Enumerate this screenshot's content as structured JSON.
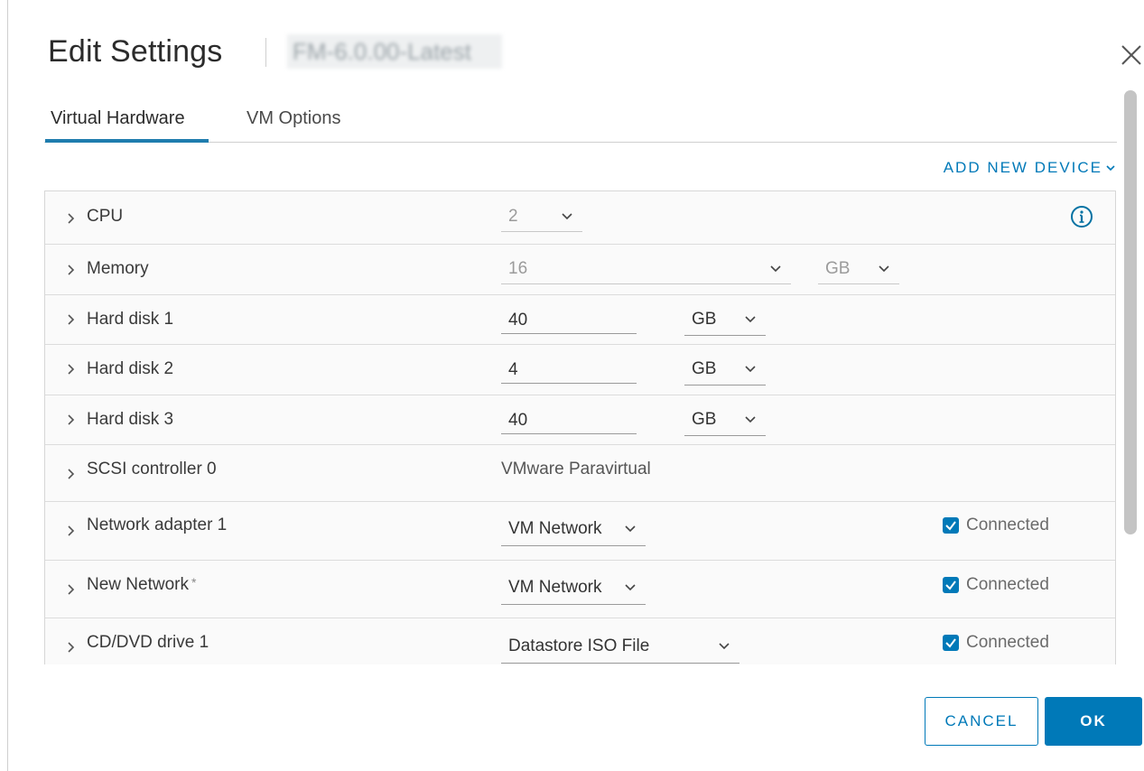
{
  "dialog": {
    "title": "Edit Settings",
    "vm_name": "FM-6.0.00-Latest"
  },
  "tabs": [
    {
      "label": "Virtual Hardware",
      "active": true
    },
    {
      "label": "VM Options",
      "active": false
    }
  ],
  "add_device_label": "ADD NEW DEVICE",
  "devices": {
    "cpu": {
      "label": "CPU",
      "value": "2"
    },
    "memory": {
      "label": "Memory",
      "value": "16",
      "unit": "GB"
    },
    "hard_disk_1": {
      "label": "Hard disk 1",
      "value": "40",
      "unit": "GB"
    },
    "hard_disk_2": {
      "label": "Hard disk 2",
      "value": "4",
      "unit": "GB"
    },
    "hard_disk_3": {
      "label": "Hard disk 3",
      "value": "40",
      "unit": "GB"
    },
    "scsi": {
      "label": "SCSI controller 0",
      "value": "VMware Paravirtual"
    },
    "net1": {
      "label": "Network adapter 1",
      "value": "VM Network",
      "connected_label": "Connected",
      "connected": true
    },
    "new_net": {
      "label": "New Network",
      "marker": "*",
      "value": "VM Network",
      "connected_label": "Connected",
      "connected": true
    },
    "cdrom": {
      "label": "CD/DVD drive 1",
      "value": "Datastore ISO File",
      "connected_label": "Connected",
      "connected": true
    }
  },
  "footer": {
    "cancel_label": "CANCEL",
    "ok_label": "OK"
  },
  "colors": {
    "accent": "#0079b8",
    "tab_indicator": "#1f7dae"
  },
  "icons": {
    "close": "close-icon",
    "chevron": "chevron-right-icon",
    "caret": "chevron-down-icon",
    "info": "info-icon",
    "check": "checkmark-icon"
  }
}
